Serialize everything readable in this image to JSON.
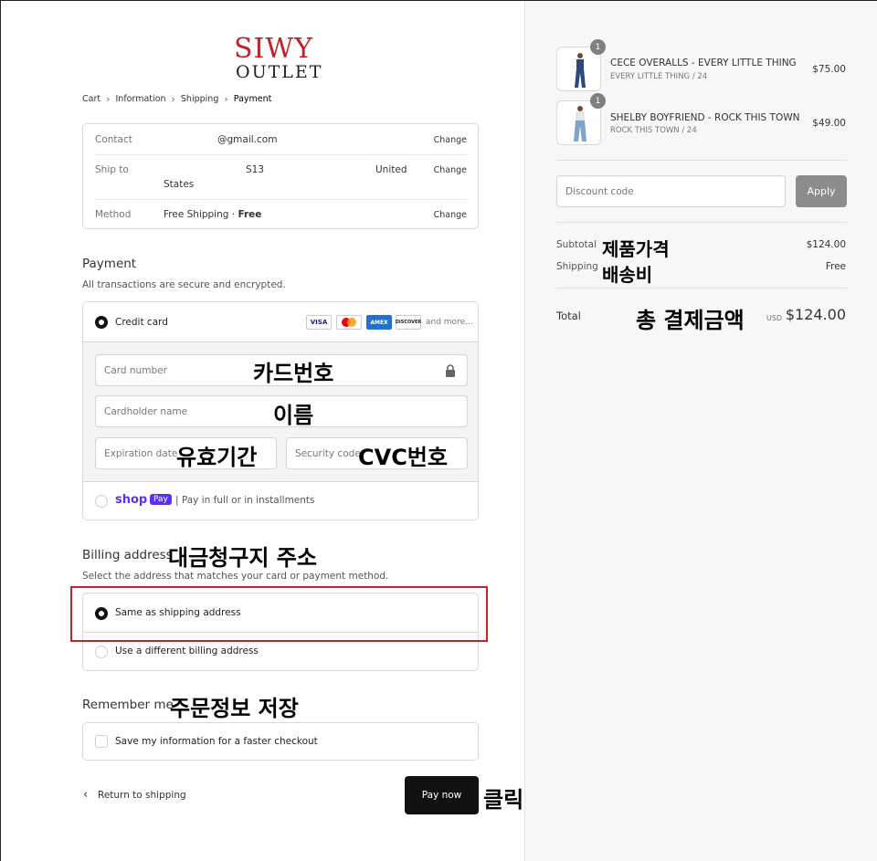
{
  "brand": {
    "line1": "SIWY",
    "line2": "OUTLET"
  },
  "breadcrumb": [
    "Cart",
    "Information",
    "Shipping",
    "Payment"
  ],
  "summary_box": {
    "contact_label": "Contact",
    "contact_value": "@gmail.com",
    "shipto_label": "Ship to",
    "shipto_value_1": "S13",
    "shipto_value_2": "United",
    "shipto_value_3": "States",
    "method_label": "Method",
    "method_value": "Free Shipping · ",
    "method_value_bold": "Free",
    "change": "Change"
  },
  "payment": {
    "title": "Payment",
    "subtitle": "All transactions are secure and encrypted.",
    "credit_card_label": "Credit card",
    "card_logos": [
      "VISA",
      "AMEX",
      "DISCOVER"
    ],
    "and_more": "and more...",
    "card_number_placeholder": "Card number",
    "cardholder_placeholder": "Cardholder name",
    "expiration_placeholder": "Expiration date",
    "security_placeholder": "Security code",
    "shop_text": "shop",
    "pay_badge": "Pay",
    "shoppay_text": "| Pay in full or in installments"
  },
  "billing": {
    "title": "Billing address",
    "subtitle": "Select the address that matches your card or payment method.",
    "same": "Same as shipping address",
    "different": "Use a different billing address"
  },
  "remember": {
    "title": "Remember me",
    "save": "Save my information for a faster checkout"
  },
  "footer": {
    "return": "Return to shipping",
    "pay_now": "Pay now"
  },
  "annotations": {
    "card_number": "카드번호",
    "name": "이름",
    "expiry": "유효기간",
    "cvc": "CVC번호",
    "billing": "대금청구지 주소",
    "remember": "주문정보 저장",
    "click": "클릭",
    "subtotal": "제품가격",
    "shipping": "배송비",
    "total": "총 결제금액"
  },
  "cart": {
    "items": [
      {
        "qty": "1",
        "name": "CECE OVERALLS - EVERY LITTLE THING",
        "variant": "EVERY LITTLE THING / 24",
        "price": "$75.00"
      },
      {
        "qty": "1",
        "name": "SHELBY BOYFRIEND - ROCK THIS TOWN",
        "variant": "ROCK THIS TOWN / 24",
        "price": "$49.00"
      }
    ],
    "discount_placeholder": "Discount code",
    "apply": "Apply",
    "subtotal_label": "Subtotal",
    "subtotal_value": "$124.00",
    "shipping_label": "Shipping",
    "shipping_value": "Free",
    "total_label": "Total",
    "currency": "USD",
    "total_value": "$124.00"
  },
  "colors": {
    "brand_red": "#c0242b",
    "shop_purple": "#5a31f4",
    "highlight_red": "#c3262f"
  }
}
